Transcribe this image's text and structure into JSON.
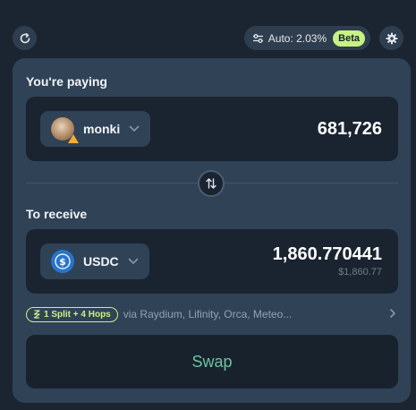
{
  "topbar": {
    "slippage_label": "Auto: 2.03%",
    "beta_label": "Beta"
  },
  "pay": {
    "label": "You're paying",
    "token": "monki",
    "amount": "681,726"
  },
  "receive": {
    "label": "To receive",
    "token": "USDC",
    "amount": "1,860.770441",
    "amount_usd": "$1,860.77"
  },
  "route": {
    "badge": "1 Split + 4 Hops",
    "via": "via Raydium, Lifinity, Orca, Meteo..."
  },
  "swap_button": "Swap",
  "colors": {
    "background": "#1b2531",
    "card": "#304256",
    "accent_lime": "#c7f284",
    "swap_text": "#6cc2a0"
  },
  "icons": [
    "refresh-icon",
    "sliders-icon",
    "gear-icon",
    "chevron-down-icon",
    "swap-arrows-icon",
    "warning-icon",
    "usdc-dollar-icon",
    "route-icon",
    "chevron-right-icon"
  ]
}
